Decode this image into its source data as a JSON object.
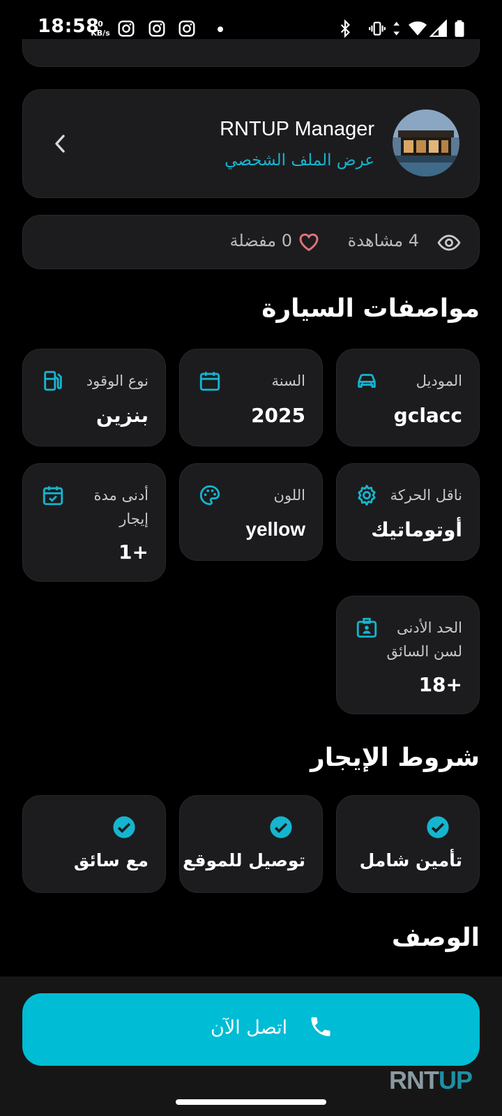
{
  "status_bar": {
    "time": "18:58",
    "net_value": "0",
    "net_unit": "KB/s"
  },
  "profile": {
    "name": "RNTUP Manager",
    "link": "عرض الملف الشخصي"
  },
  "stats": {
    "views": "4 مشاهدة",
    "favorites": "0 مفضلة"
  },
  "specs_title": "مواصفات السيارة",
  "specs": {
    "model_label": "الموديل",
    "model_value": "gclacc",
    "year_label": "السنة",
    "year_value": "2025",
    "fuel_label": "نوع الوقود",
    "fuel_value": "بنزين",
    "transmission_label": "ناقل الحركة",
    "transmission_value": "أوتوماتيك",
    "color_label": "اللون",
    "color_value": "yellow",
    "min_rent_label_1": "أدنى مدة",
    "min_rent_label_2": "إيجار",
    "min_rent_value": "+1",
    "min_age_label_1": "الحد الأدنى",
    "min_age_label_2": "لسن السائق",
    "min_age_value": "+18"
  },
  "terms_title": "شروط الإيجار",
  "terms": [
    "تأمين شامل",
    "توصيل للموقع",
    "مع سائق"
  ],
  "description_title": "الوصف",
  "call_button": "اتصل الآن",
  "brand": {
    "part1": "RNT",
    "part2": "UP"
  },
  "colors": {
    "accent": "#00bcd4",
    "card": "#1c1c1e",
    "heart": "#e5737a"
  }
}
